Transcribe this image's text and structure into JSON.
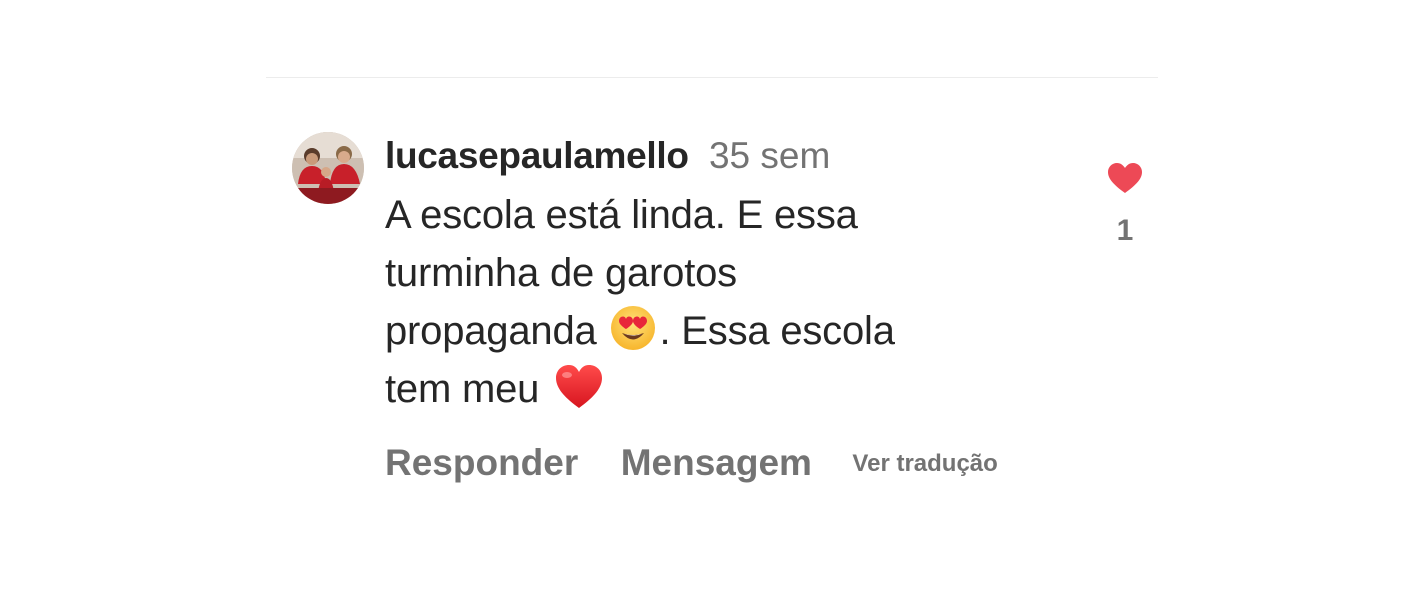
{
  "comment": {
    "username": "lucasepaulamello",
    "timestamp": "35 sem",
    "text_line_1": "A escola está linda. E essa",
    "text_line_2": "turminha de garotos",
    "text_line_3_before_emoji": "propaganda",
    "text_line_3_after_emoji": ". Essa escola",
    "text_line_4": "tem meu",
    "emojis": [
      "heart-eyes-emoji",
      "red-heart-emoji"
    ],
    "like_count": "1",
    "liked": true
  },
  "actions": {
    "reply_label": "Responder",
    "message_label": "Mensagem",
    "translate_label": "Ver tradução"
  },
  "colors": {
    "like_red": "#ed4956",
    "muted_text": "#737373",
    "primary_text": "#262626"
  }
}
